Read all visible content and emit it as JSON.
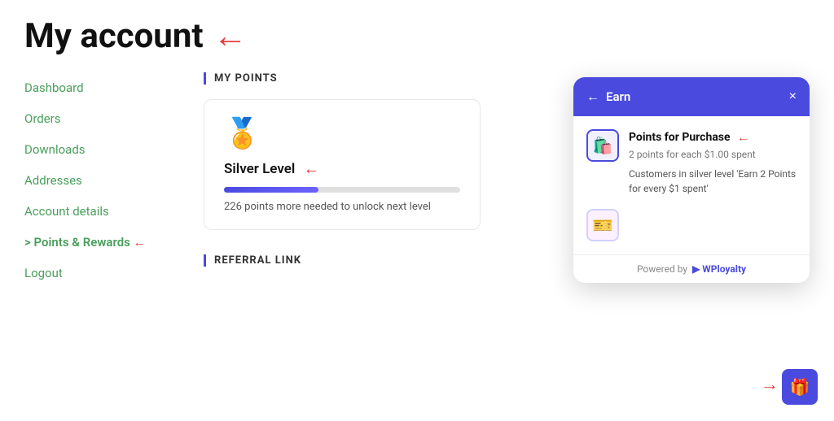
{
  "page": {
    "title": "My account",
    "title_arrow": "←"
  },
  "sidebar": {
    "items": [
      {
        "label": "Dashboard",
        "active": false
      },
      {
        "label": "Orders",
        "active": false
      },
      {
        "label": "Downloads",
        "active": false
      },
      {
        "label": "Addresses",
        "active": false
      },
      {
        "label": "Account details",
        "active": false
      },
      {
        "label": "> Points & Rewards",
        "active": true
      },
      {
        "label": "Logout",
        "active": false
      }
    ]
  },
  "main": {
    "my_points_title": "MY POINTS",
    "referral_link_title": "REFERRAL LINK",
    "points_card": {
      "level": "Silver Level",
      "note": "226 points more needed to unlock next level",
      "progress_percent": 40
    }
  },
  "earn_popup": {
    "title": "Earn",
    "back_label": "←",
    "close_label": "×",
    "item1": {
      "title": "Points for Purchase",
      "subtitle": "2 points for each $1.00 spent",
      "description": "Customers in silver level 'Earn 2 Points for every $1 spent'"
    },
    "item2": {
      "label": ""
    },
    "footer": "Powered by",
    "footer_brand": "WPloyalty"
  },
  "gift_button": {
    "icon": "🎁"
  }
}
